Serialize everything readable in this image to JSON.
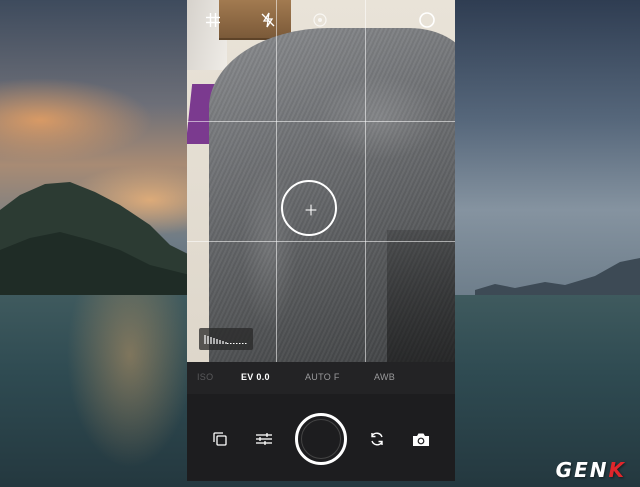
{
  "camera": {
    "settings": [
      {
        "key": "iso",
        "label": "ISO",
        "active": false
      },
      {
        "key": "ev",
        "label": "EV 0.0",
        "active": true
      },
      {
        "key": "focus",
        "label": "AUTO F",
        "active": false
      },
      {
        "key": "wb",
        "label": "AWB",
        "active": false
      }
    ],
    "top_icons": [
      "grid-icon",
      "flash-off-icon",
      "timer-icon",
      "settings-icon"
    ],
    "bottom_icons": [
      "gallery-icon",
      "adjust-icon",
      "shutter-button",
      "flip-camera-icon",
      "camera-mode-icon"
    ]
  },
  "watermark": {
    "prefix": "GEN",
    "accent": "K"
  },
  "colors": {
    "accent": "#e0262b",
    "panel": "#1d1d1f",
    "active_text": "#ffffff",
    "inactive_text": "#9a9a9c"
  }
}
